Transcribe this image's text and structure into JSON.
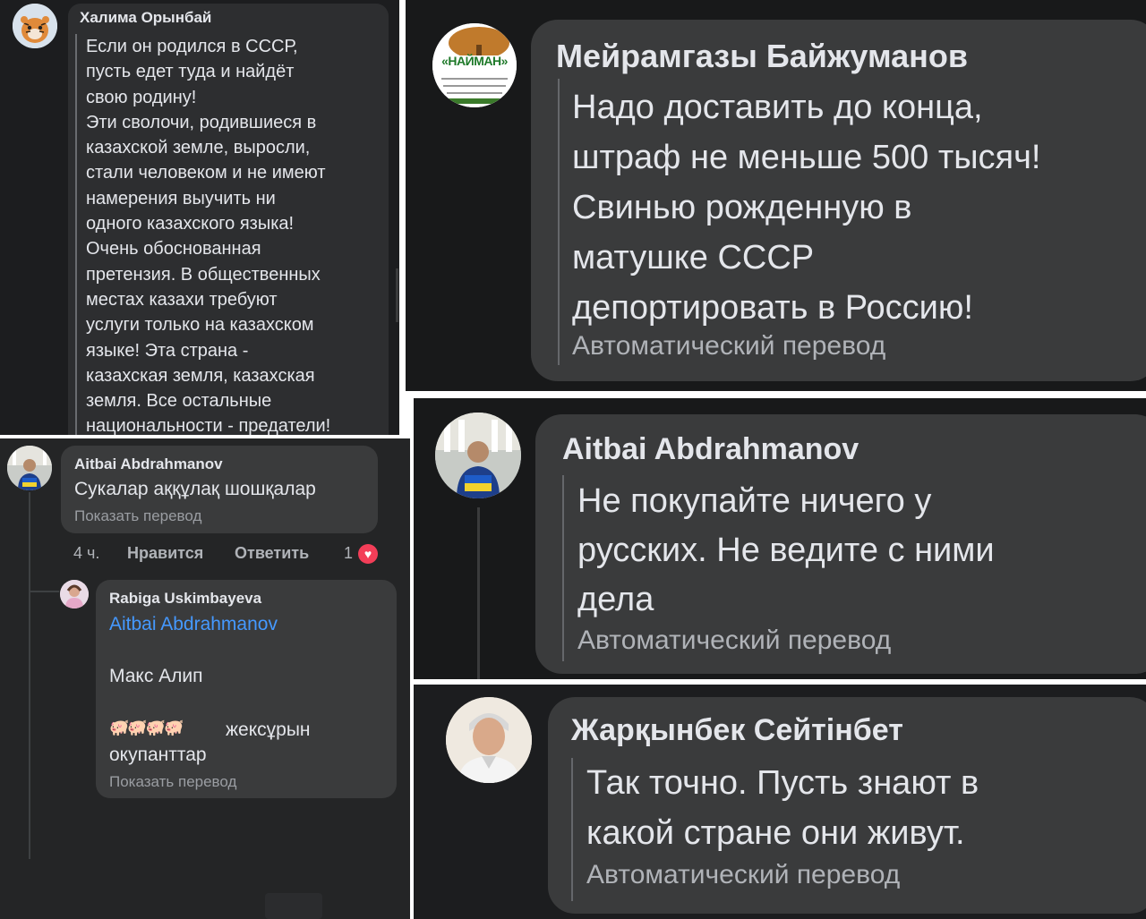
{
  "panel1": {
    "author": "Халима Орынбай",
    "text": "Если он родился в СССР,\nпусть едет туда и найдёт\nсвою родину!\nЭти сволочи, родившиеся в\nказахской земле, выросли,\nстали человеком и не имеют\nнамерения выучить ни\nодного казахского языка!\nОчень обоснованная\nпретензия. В общественных\nместах казахи требуют\nуслуги только на казахском\nязыке! Эта страна -\nказахская земля, казахская\nземля. Все остальные\nнациональности - предатели!"
  },
  "panel2": {
    "author": "Мейрамгазы Байжуманов",
    "avatar_logo_text": "«НАЙМАН»",
    "text": "Надо доставить до конца,\nштраф не меньше 500 тысяч!\nСвинью рожденную в\nматушке СССР\nдепортировать в Россию!",
    "auto_translate": "Автоматический перевод"
  },
  "panel3": {
    "comment": {
      "author": "Aitbai Abdrahmanov",
      "text": "Сукалар аққұлақ шошқалар",
      "show_translation": "Показать перевод"
    },
    "actions": {
      "time": "4 ч.",
      "like": "Нравится",
      "reply": "Ответить",
      "reaction_count": "1"
    },
    "reply": {
      "author": "Rabiga Uskimbayeva",
      "mention": "Aitbai Abdrahmanov",
      "line1": "Макс Алип",
      "emoji": "🐖🐖🐖🐖",
      "line2_a": "жексұрын",
      "line2_b": "окупанттар",
      "show_translation": "Показать перевод"
    }
  },
  "panel4": {
    "author": "Aitbai Abdrahmanov",
    "text": "Не покупайте ничего у\nрусских. Не ведите с ними\nдела",
    "auto_translate": "Автоматический перевод"
  },
  "panel5": {
    "author": "Жарқынбек Сейтінбет",
    "text": "Так точно. Пусть знают в\nкакой стране они живут.",
    "auto_translate": "Автоматический перевод"
  },
  "colors": {
    "background": "#18191a",
    "bubble": "#3a3b3c",
    "text": "#e4e6eb",
    "muted": "#b0b3b8",
    "link": "#4599ff",
    "reaction": "#f33e58"
  }
}
